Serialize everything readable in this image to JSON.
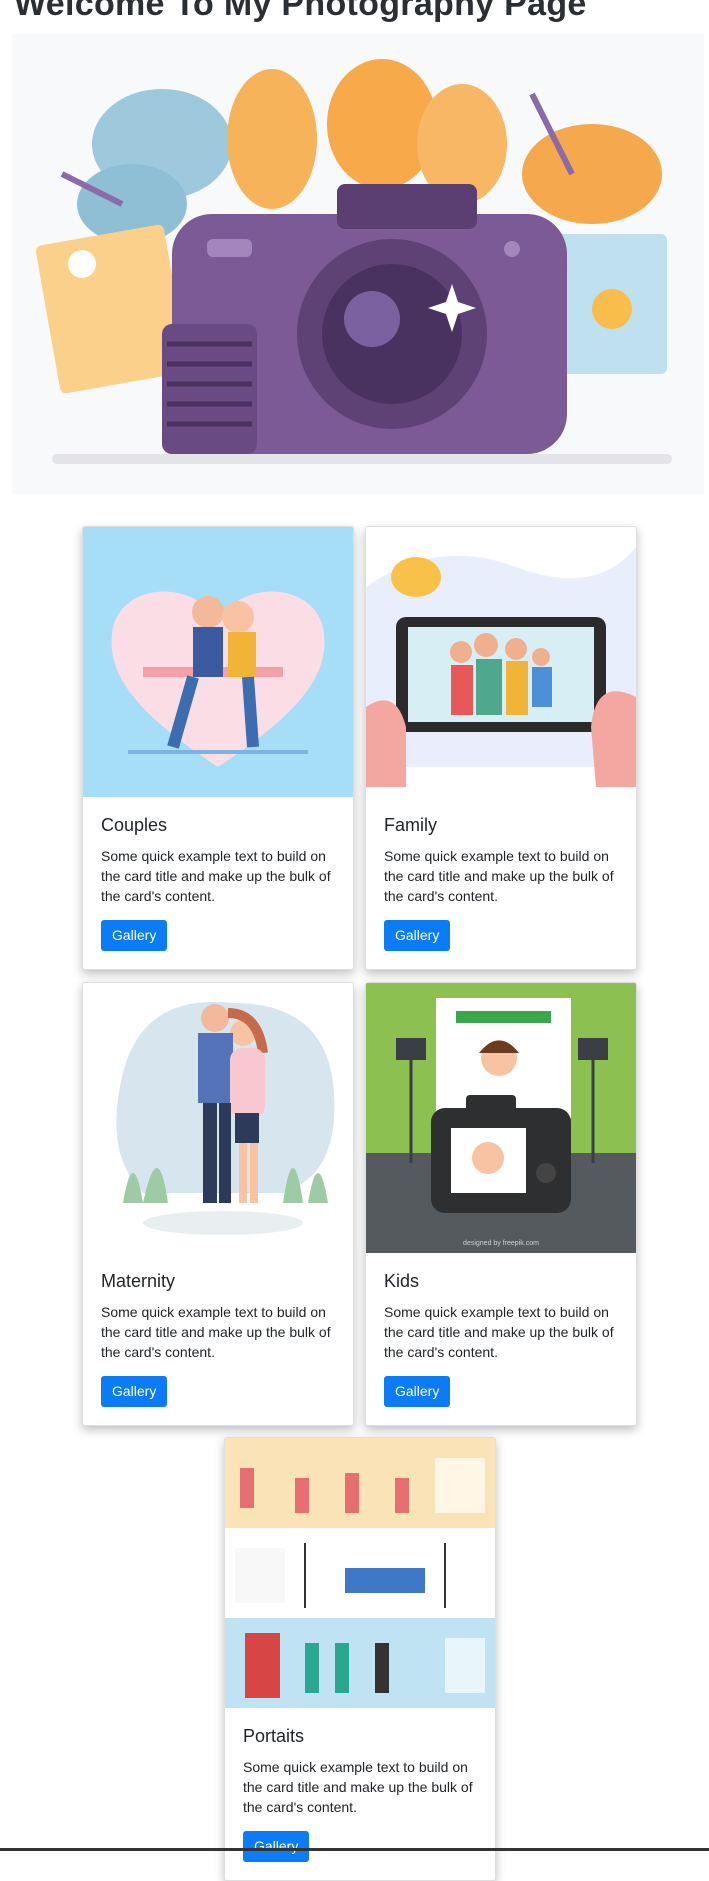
{
  "page": {
    "title": "Welcome To My Photography Page"
  },
  "hero": {
    "icon": "camera-illustration"
  },
  "cards": [
    {
      "title": "Couples",
      "text": "Some quick example text to build on the card title and make up the bulk of the card's content.",
      "button": "Gallery",
      "image": "couple-illustration"
    },
    {
      "title": "Family",
      "text": "Some quick example text to build on the card title and make up the bulk of the card's content.",
      "button": "Gallery",
      "image": "family-photo-illustration"
    },
    {
      "title": "Maternity",
      "text": "Some quick example text to build on the card title and make up the bulk of the card's content.",
      "button": "Gallery",
      "image": "maternity-illustration"
    },
    {
      "title": "Kids",
      "text": "Some quick example text to build on the card title and make up the bulk of the card's content.",
      "button": "Gallery",
      "image": "kids-studio-illustration"
    },
    {
      "title": "Portaits",
      "text": "Some quick example text to build on the card title and make up the bulk of the card's content.",
      "button": "Gallery",
      "image": "portraits-collage-illustration"
    }
  ],
  "colors": {
    "button": "#0b7bf6",
    "title": "#2b2f33",
    "hero_bg": "#f8f9fa"
  }
}
